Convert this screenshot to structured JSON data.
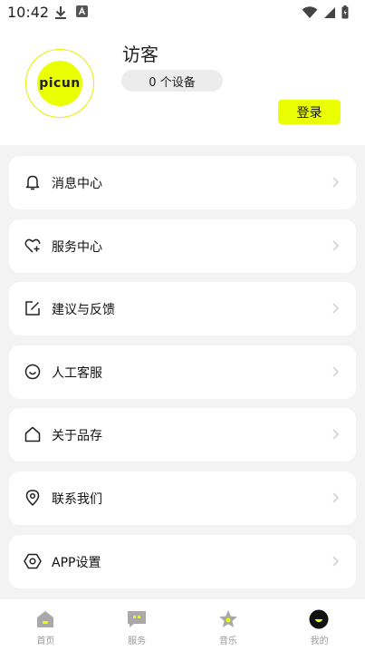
{
  "status_bar": {
    "time": "10:42"
  },
  "profile": {
    "avatar_text": "picun",
    "username": "访客",
    "device_count": "0 个设备",
    "login_label": "登录"
  },
  "menu": [
    {
      "label": "消息中心",
      "icon": "bell-icon"
    },
    {
      "label": "服务中心",
      "icon": "heart-plus-icon"
    },
    {
      "label": "建议与反馈",
      "icon": "edit-icon"
    },
    {
      "label": "人工客服",
      "icon": "smile-icon"
    },
    {
      "label": "关于品存",
      "icon": "home-icon"
    },
    {
      "label": "联系我们",
      "icon": "location-icon"
    },
    {
      "label": "APP设置",
      "icon": "settings-icon"
    }
  ],
  "tabs": [
    {
      "label": "首页",
      "icon": "home-tab-icon"
    },
    {
      "label": "服务",
      "icon": "chat-tab-icon"
    },
    {
      "label": "音乐",
      "icon": "star-music-tab-icon"
    },
    {
      "label": "我的",
      "icon": "profile-tab-icon"
    }
  ],
  "colors": {
    "accent": "#eaff00",
    "background": "#f3f3f3",
    "tab_inactive": "#9a9a9a"
  }
}
